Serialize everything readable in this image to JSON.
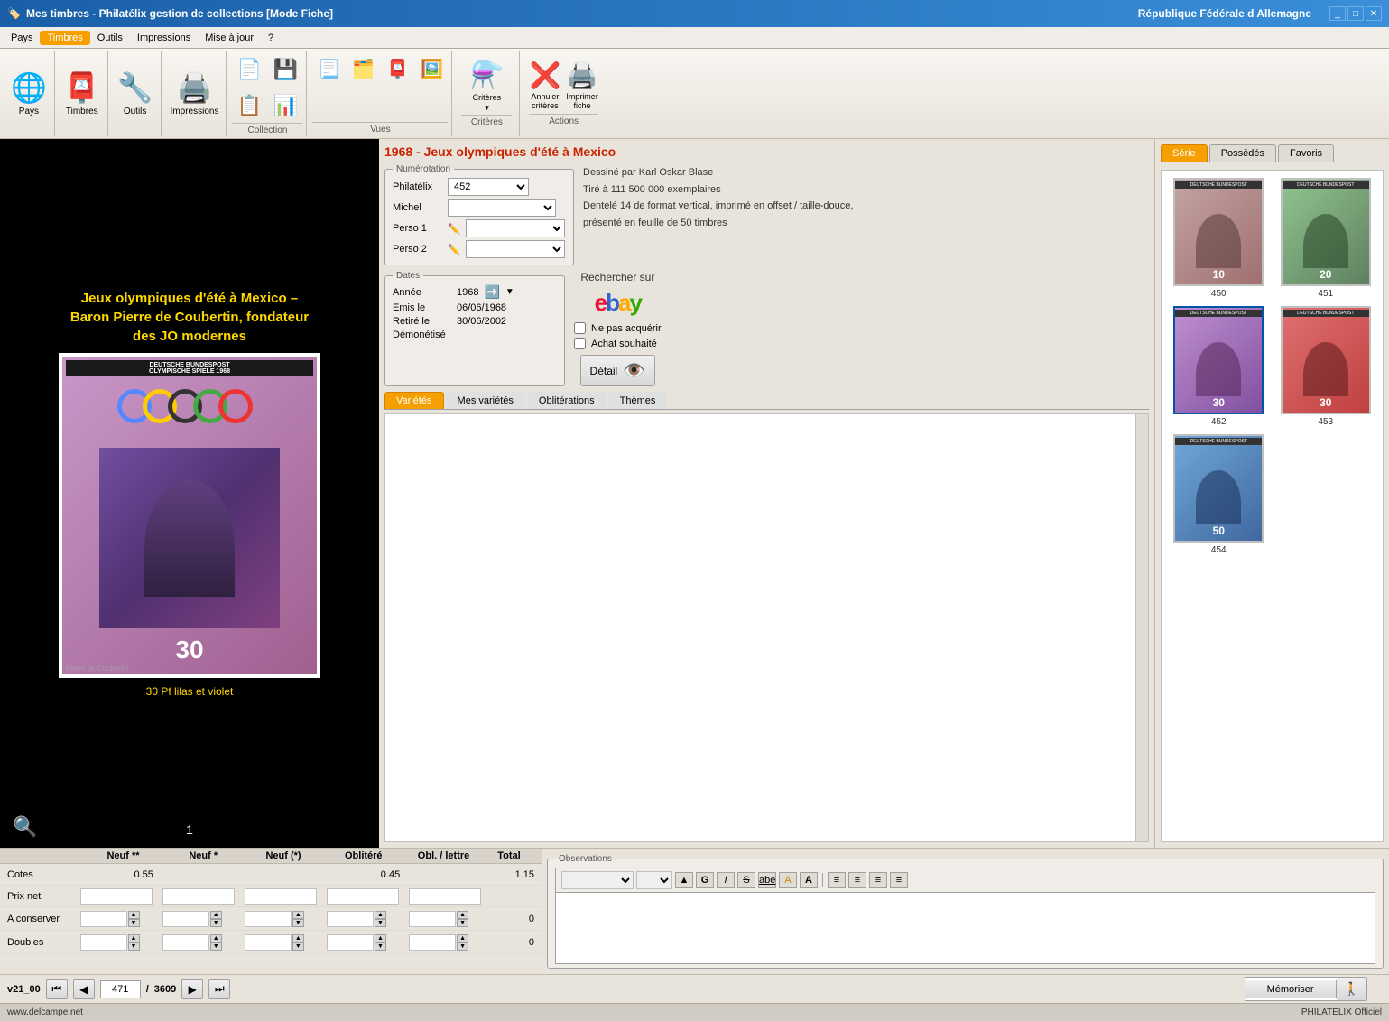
{
  "titleBar": {
    "title": "Mes timbres - Philatélix gestion de collections [Mode Fiche]",
    "rightTitle": "République Fédérale d Allemagne",
    "controls": [
      "_",
      "□",
      "✕"
    ]
  },
  "menuBar": {
    "items": [
      "Pays",
      "Timbres",
      "Outils",
      "Impressions",
      "Mise à jour",
      "?"
    ],
    "activeIndex": 1
  },
  "toolbar": {
    "groups": [
      {
        "label": "Pays",
        "icon": "🌐"
      },
      {
        "label": "Timbres",
        "icon": "📮"
      },
      {
        "label": "Outils",
        "icon": "🔧"
      },
      {
        "label": "Impressions",
        "icon": "🖨️"
      },
      {
        "label": "Collection",
        "sublabel": "Collection"
      },
      {
        "label": "Vues",
        "sublabel": "Vues"
      },
      {
        "label": "Critères",
        "sublabel": "Critères"
      },
      {
        "label": "Actions",
        "sublabel": "Actions"
      }
    ],
    "buttons": {
      "criteres": "Critères",
      "annuler_criteres": "Annuler critères",
      "imprimer_fiche": "Imprimer fiche"
    }
  },
  "stampDisplay": {
    "title": "Jeux olympiques d'été à Mexico –\nBaron Pierre de Coubertin, fondateur\ndes JO modernes",
    "subtitle": "30 Pf lilas et violet",
    "header": "DEUTSCHE BUNDESPOST\nOLYMPISCHE SPIELE 1968",
    "value": "30",
    "zoomIcon": "🔍",
    "number": "1"
  },
  "seriesTitle": "1968 - Jeux olympiques d'été à Mexico",
  "numerotation": {
    "legend": "Numérotation",
    "rows": [
      {
        "label": "Philatélix",
        "value": "452",
        "type": "select"
      },
      {
        "label": "Michel",
        "value": "",
        "type": "select"
      },
      {
        "label": "Perso 1",
        "value": "",
        "type": "select",
        "hasEdit": true
      },
      {
        "label": "Perso 2",
        "value": "",
        "type": "select",
        "hasEdit": true
      }
    ]
  },
  "description": {
    "line1": "Dessiné par Karl Oskar Blase",
    "line2": "Tiré à 111 500 000 exemplaires",
    "line3": "Dentelé 14 de format vertical, imprimé en offset / taille-douce,",
    "line4": "présenté en feuille de 50 timbres"
  },
  "dates": {
    "legend": "Dates",
    "rows": [
      {
        "label": "Année",
        "value": "1968",
        "hasArrow": true
      },
      {
        "label": "Emis le",
        "value": "06/06/1968"
      },
      {
        "label": "Retiré le",
        "value": "30/06/2002"
      },
      {
        "label": "Démonétisé",
        "value": ""
      }
    ]
  },
  "ebay": {
    "searchLabel": "Rechercher sur",
    "logoLetters": [
      "e",
      "b",
      "a",
      "y"
    ]
  },
  "checkboxes": [
    {
      "label": "Ne pas acquérir",
      "checked": false
    },
    {
      "label": "Achat souhaité",
      "checked": false
    }
  ],
  "detailBtn": "Détail",
  "varietyTabs": [
    "Variétés",
    "Mes variétés",
    "Oblitérations",
    "Thèmes"
  ],
  "activeVarietyTab": 0,
  "rightPanel": {
    "tabs": [
      "Série",
      "Possédés",
      "Favoris"
    ],
    "activeTab": 0,
    "stamps": [
      {
        "num": "450",
        "color": "thumb-450",
        "selected": false
      },
      {
        "num": "451",
        "color": "thumb-451",
        "selected": false
      },
      {
        "num": "452",
        "color": "thumb-452",
        "selected": true
      },
      {
        "num": "453",
        "color": "thumb-453",
        "selected": false
      },
      {
        "num": "454",
        "color": "thumb-454",
        "selected": false,
        "single": true
      }
    ]
  },
  "pricesTable": {
    "headers": [
      "Neuf **",
      "Neuf *",
      "Neuf (*)",
      "Oblitéré",
      "Obl. / lettre",
      "Total"
    ],
    "rows": [
      {
        "label": "Cotes",
        "values": [
          "0.55",
          "",
          "",
          "0.45",
          "",
          "1.15"
        ]
      },
      {
        "label": "Prix net",
        "values": [
          "",
          "",
          "",
          "",
          "",
          ""
        ]
      },
      {
        "label": "A conserver",
        "values": [
          "",
          "",
          "",
          "",
          "",
          "0"
        ]
      },
      {
        "label": "Doubles",
        "values": [
          "",
          "",
          "",
          "",
          "",
          "0"
        ]
      }
    ]
  },
  "navigation": {
    "current": "471",
    "total": "3609",
    "separator": "/"
  },
  "observations": {
    "legend": "Observations",
    "placeholder": ""
  },
  "memoriserBtn": "Mémoriser",
  "footer": {
    "left": "www.delcampe.net",
    "right": "PHILATELIX Officiel"
  }
}
